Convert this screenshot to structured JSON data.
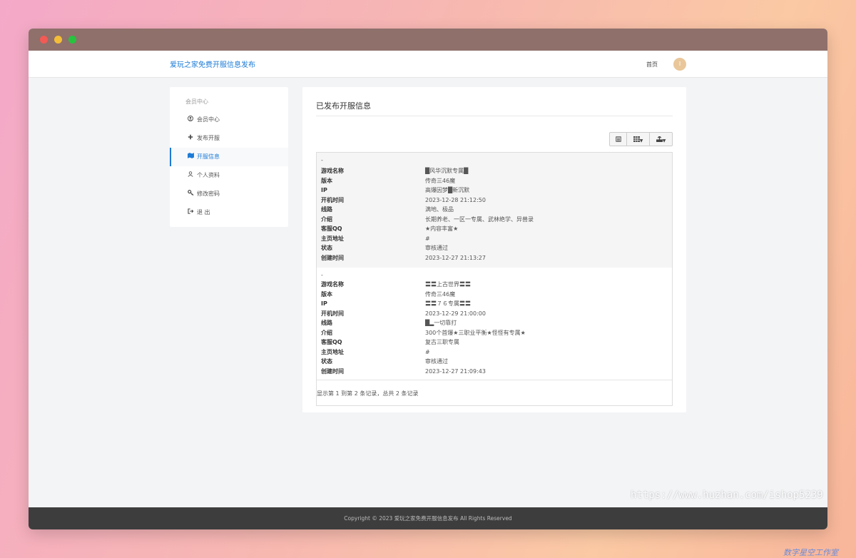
{
  "window": {
    "controls": [
      "close",
      "minimize",
      "maximize"
    ]
  },
  "navbar": {
    "brand": "爱玩之家免费开服信息发布",
    "home": "首页",
    "avatar": "I"
  },
  "sidebar": {
    "heading": "会员中心",
    "items": [
      {
        "label": "会员中心",
        "icon": "user-circle-icon"
      },
      {
        "label": "发布开服",
        "icon": "plus-icon"
      },
      {
        "label": "开服信息",
        "icon": "map-icon",
        "active": true
      },
      {
        "label": "个人资料",
        "icon": "user-icon"
      },
      {
        "label": "修改密码",
        "icon": "key-icon"
      },
      {
        "label": "退 出",
        "icon": "sign-out-icon"
      }
    ]
  },
  "main": {
    "title": "已发布开服信息",
    "toolbar": [
      "card-view-icon",
      "columns-icon",
      "export-icon"
    ],
    "records": [
      {
        "dash": "-",
        "fields": [
          {
            "k": "游戏名称",
            "v": "█风华沉默专属█"
          },
          {
            "k": "版本",
            "v": "传奇三46魔"
          },
          {
            "k": "IP",
            "v": "高爆因梦█新沉默"
          },
          {
            "k": "开机时间",
            "v": "2023-12-28 21:12:50"
          },
          {
            "k": "线路",
            "v": "满地、极品"
          },
          {
            "k": "介绍",
            "v": "长期养老、一区一专属、武林绝学、异兽录"
          },
          {
            "k": "客服QQ",
            "v": "★内容丰富★"
          },
          {
            "k": "主页地址",
            "v": "#"
          },
          {
            "k": "状态",
            "v": "审核通过"
          },
          {
            "k": "创建时间",
            "v": "2023-12-27 21:13:27"
          }
        ]
      },
      {
        "dash": "-",
        "fields": [
          {
            "k": "游戏名称",
            "v": "〓〓上古世界〓〓"
          },
          {
            "k": "版本",
            "v": "传奇三46魔"
          },
          {
            "k": "IP",
            "v": "〓〓７６专属〓〓"
          },
          {
            "k": "开机时间",
            "v": "2023-12-29 21:00:00"
          },
          {
            "k": "线路",
            "v": "█▂一切靠打"
          },
          {
            "k": "介绍",
            "v": "300个首爆★三职业平衡★怪怪有专属★"
          },
          {
            "k": "客服QQ",
            "v": "复古三职专属"
          },
          {
            "k": "主页地址",
            "v": "#"
          },
          {
            "k": "状态",
            "v": "审核通过"
          },
          {
            "k": "创建时间",
            "v": "2023-12-27 21:09:43"
          }
        ]
      }
    ],
    "pagination": "显示第 1 到第 2 条记录，总共 2 条记录"
  },
  "footer": {
    "text": "Copyright © 2023 爱玩之家免费开服信息发布 All Rights Reserved"
  },
  "watermark": {
    "url": "https://www.huzhan.com/ishop5239",
    "brand": "数字星空工作室"
  },
  "colors": {
    "accent": "#1d7bd6",
    "titlebar": "#8f706b",
    "footer": "#3d3d3d"
  }
}
